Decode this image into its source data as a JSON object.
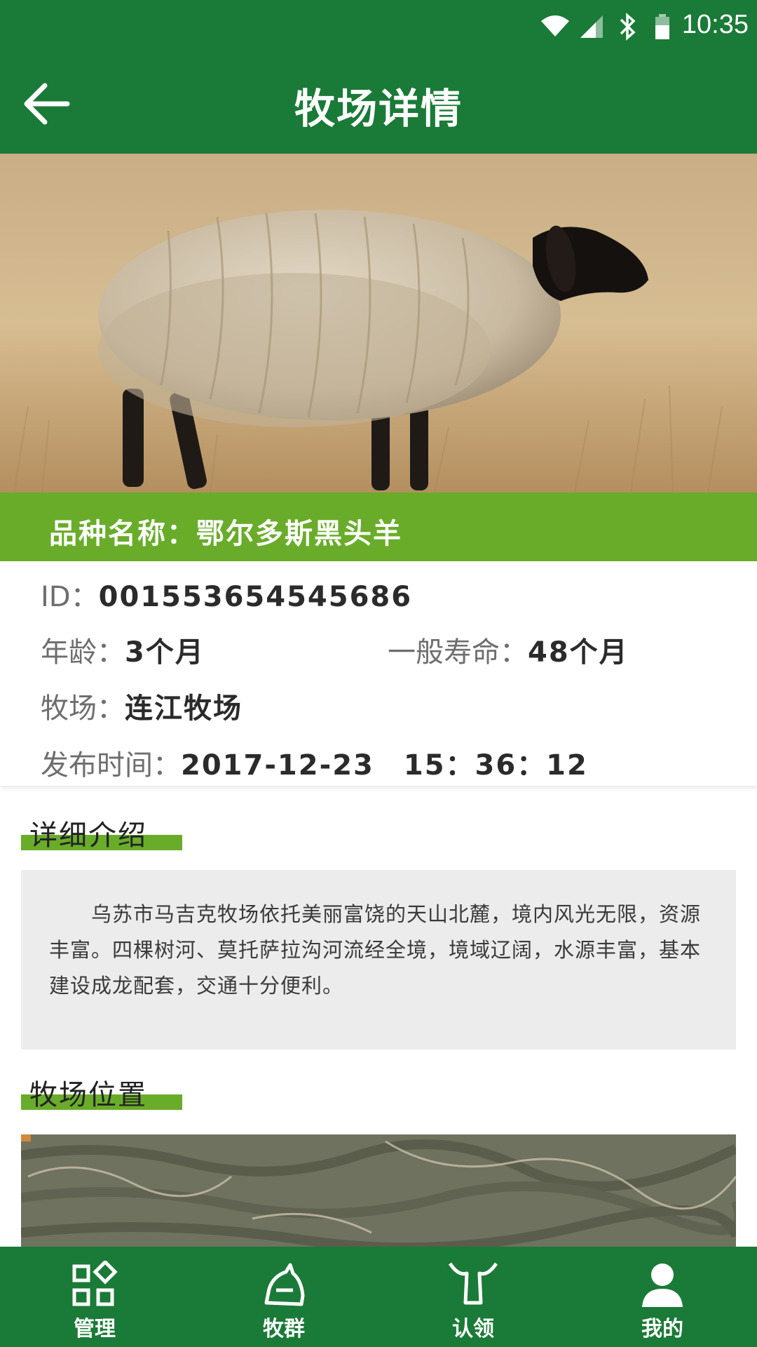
{
  "status_bar": {
    "time": "10:35"
  },
  "header": {
    "title": "牧场详情"
  },
  "hero": {
    "image": "black-headed-sheep-photo"
  },
  "breed": {
    "text": "品种名称：鄂尔多斯黑头羊"
  },
  "info": {
    "id_label": "ID：",
    "id_value": "001553654545686",
    "age_label": "年龄：",
    "age_value": "3个月",
    "life_label": "一般寿命：",
    "life_value": "48个月",
    "ranch_label": "牧场：",
    "ranch_value": "连江牧场",
    "publish_label": "发布时间：",
    "publish_value": "2017-12-23　15：36：12"
  },
  "intro": {
    "title": "详细介绍",
    "text": "乌苏市马吉克牧场依托美丽富饶的天山北麓，境内风光无限，资源丰富。四棵树河、莫托萨拉沟河流经全境，境域辽阔，水源丰富，基本建设成龙配套，交通十分便利。"
  },
  "location": {
    "title": "牧场位置"
  },
  "nav": {
    "items": [
      {
        "label": "管理",
        "icon": "grid-icon"
      },
      {
        "label": "牧群",
        "icon": "horse-icon"
      },
      {
        "label": "认领",
        "icon": "horns-icon"
      },
      {
        "label": "我的",
        "icon": "user-icon"
      }
    ]
  },
  "colors": {
    "primary": "#1a7a37",
    "accent": "#69ac2a"
  }
}
